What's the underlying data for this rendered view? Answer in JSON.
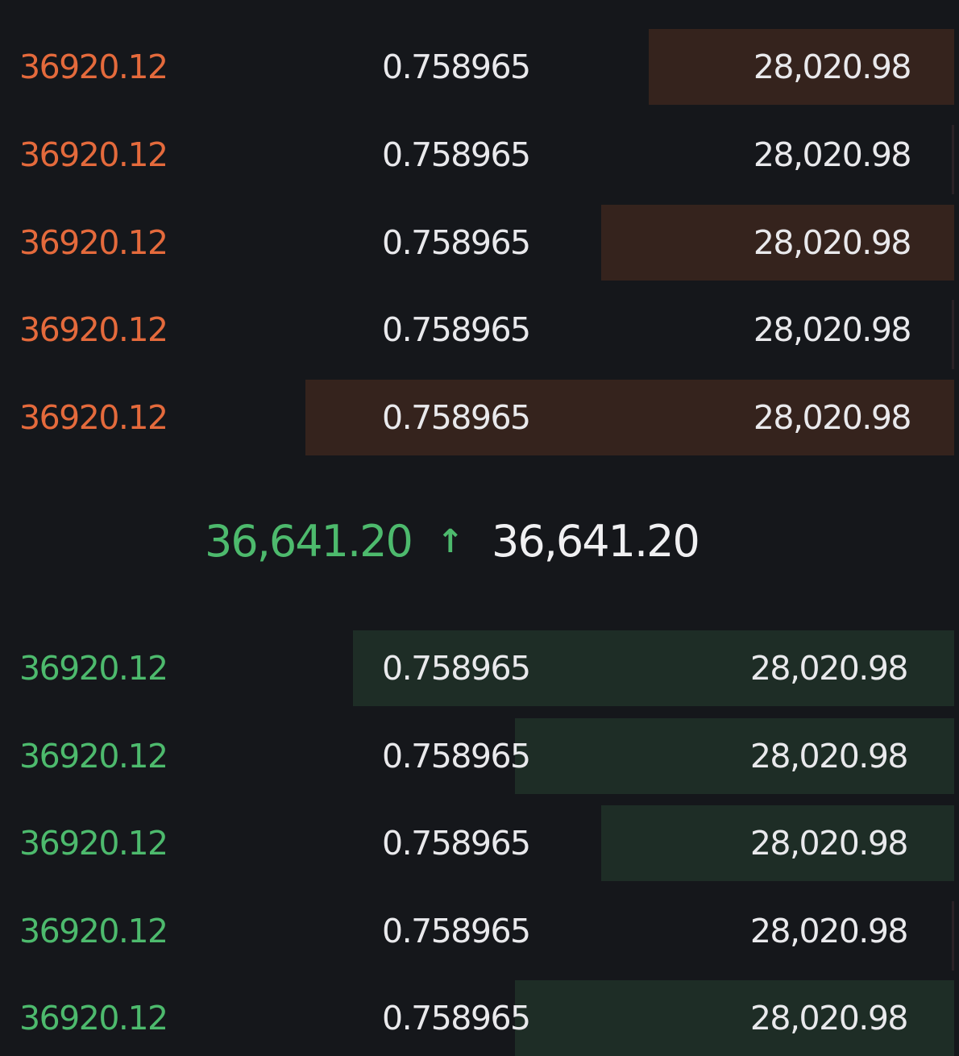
{
  "orderbook": {
    "colors": {
      "ask_price": "#e46a3c",
      "bid_price": "#4dba6d",
      "ask_depth": "#35231d",
      "bid_depth": "#1e2d26",
      "background": "#15171b"
    },
    "asks": [
      {
        "price": "36920.12",
        "amount": "0.758965",
        "total": "28,020.98",
        "depth_fraction": 0.32
      },
      {
        "price": "36920.12",
        "amount": "0.758965",
        "total": "28,020.98",
        "depth_fraction": 0.0
      },
      {
        "price": "36920.12",
        "amount": "0.758965",
        "total": "28,020.98",
        "depth_fraction": 0.37
      },
      {
        "price": "36920.12",
        "amount": "0.758965",
        "total": "28,020.98",
        "depth_fraction": 0.0
      },
      {
        "price": "36920.12",
        "amount": "0.758965",
        "total": "28,020.98",
        "depth_fraction": 0.68
      }
    ],
    "mid": {
      "last_price": "36,641.20",
      "direction_icon": "arrow-up-icon",
      "mark_price": "36,641.20"
    },
    "bids": [
      {
        "price": "36920.12",
        "amount": "0.758965",
        "total": "28,020.98",
        "depth_fraction": 0.63
      },
      {
        "price": "36920.12",
        "amount": "0.758965",
        "total": "28,020.98",
        "depth_fraction": 0.46
      },
      {
        "price": "36920.12",
        "amount": "0.758965",
        "total": "28,020.98",
        "depth_fraction": 0.37
      },
      {
        "price": "36920.12",
        "amount": "0.758965",
        "total": "28,020.98",
        "depth_fraction": 0.0
      },
      {
        "price": "36920.12",
        "amount": "0.758965",
        "total": "28,020.98",
        "depth_fraction": 0.46
      }
    ]
  }
}
